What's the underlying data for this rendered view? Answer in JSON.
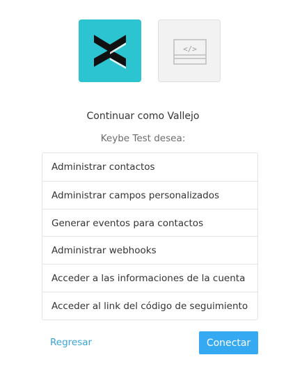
{
  "logos": {
    "brand_logo_icon": "keybe-chevrons-logo-icon",
    "brand_color": "#2cc4d0",
    "app_logo_icon": "code-window-icon",
    "app_logo_color": "#f2f2f2"
  },
  "header": {
    "continue_as": "Continuar como Vallejo",
    "app_wants": "Keybe Test desea:"
  },
  "permissions": [
    {
      "label": "Administrar contactos"
    },
    {
      "label": "Administrar campos personalizados"
    },
    {
      "label": "Generar eventos para contactos"
    },
    {
      "label": "Administrar webhooks"
    },
    {
      "label": "Acceder a las informaciones de la cuenta"
    },
    {
      "label": "Acceder al link del código de seguimiento"
    }
  ],
  "actions": {
    "back_label": "Regresar",
    "back_color": "#3aa4d8",
    "connect_label": "Conectar",
    "connect_color": "#35a9f2"
  }
}
